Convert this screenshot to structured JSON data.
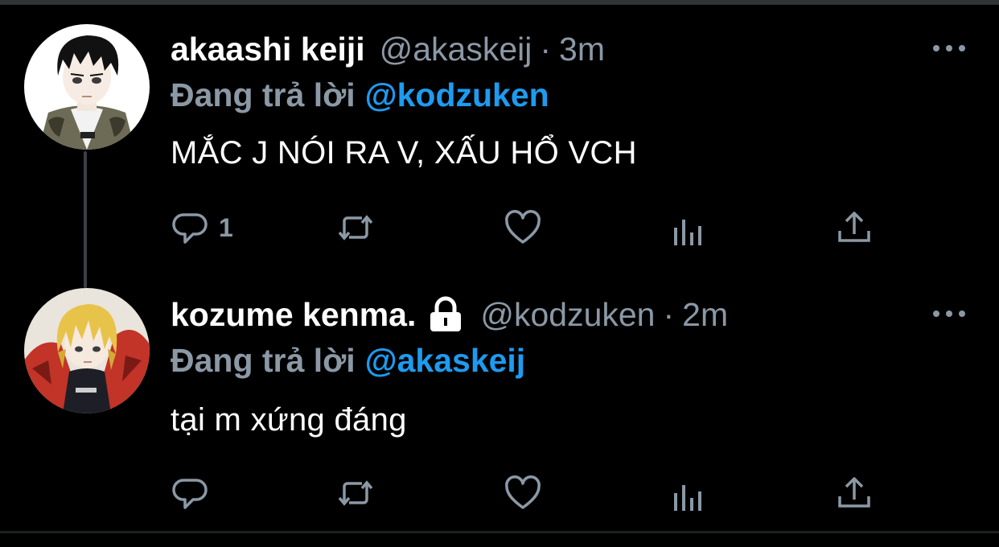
{
  "tweets": [
    {
      "name": "akaashi keiji",
      "handle": "@akaskeij",
      "separator": "·",
      "time": "3m",
      "reply_prefix": "Đang trả lời",
      "reply_to": "@kodzuken",
      "text": "MẮC J NÓI RA V, XẤU HỔ VCH",
      "reply_count": "1"
    },
    {
      "name": "kozume kenma.",
      "handle": "@kodzuken",
      "separator": "·",
      "time": "2m",
      "reply_prefix": "Đang trả lời",
      "reply_to": "@akaskeij",
      "text": "tại m xứng đáng",
      "protected_icon": "lock-icon"
    }
  ],
  "colors": {
    "background": "#000000",
    "secondary_text": "#8b98a5",
    "link": "#1d9bf0",
    "thread_line": "#3b3f44"
  },
  "icons": [
    "reply-icon",
    "retweet-icon",
    "like-icon",
    "analytics-icon",
    "share-icon",
    "more-icon",
    "lock-icon"
  ]
}
